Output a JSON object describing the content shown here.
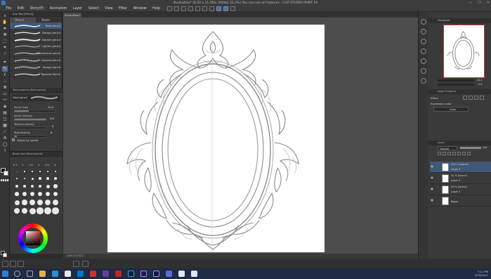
{
  "window": {
    "title": "Illustration* (8.50 x 11.00in 300dpi 32.2%) You can use all features - CLIP STUDIO PAINT EX",
    "controls": [
      "—",
      "☐",
      "✕"
    ]
  },
  "menu": [
    "File",
    "Edit",
    "Story(P)",
    "Animation",
    "Layer",
    "Select",
    "View",
    "Filter",
    "Window",
    "Help"
  ],
  "document_tab": "Illustration*",
  "subtool_panel": {
    "header": "Sub Tool [Pencil]",
    "tabs": [
      "Pencil",
      "Pastel"
    ],
    "brushes": [
      "Real pencil",
      "Design pencil",
      "Darker pencil",
      "Lighter pencil",
      "Mechanical pencil",
      "Colored pencil",
      "Rough pencil",
      "Tapered Pencil"
    ],
    "selected_index": 0
  },
  "tool_property": {
    "header": "Tool property [Real pencil]",
    "preset": "Real pencil",
    "brush_size_label": "Brush Size",
    "brush_size_value": "20.0",
    "brush_density_label": "Brush density",
    "brush_density_value": "100",
    "texture_density_label": "Texture density",
    "texture_density_value": "0",
    "stabilization_label": "Stabilization",
    "stabilization_value": "6",
    "adjust_by_speed_label": "Adjust by speed"
  },
  "brush_size_panel": {
    "header": "Brush size [Real pencil]",
    "sizes": [
      "0.7",
      "1",
      "1.5",
      "2",
      "2.5",
      "3"
    ]
  },
  "canvas": {
    "status": "1.8%  0.0  32.2"
  },
  "navigator": {
    "header": "Navigator",
    "zoom": "32.2",
    "rotation": "0.0"
  },
  "layer_property": {
    "header": "Layer Property",
    "effect_label": "Effect",
    "expression_color_label": "Expression color",
    "expression_color_value": "Color"
  },
  "layer_panel": {
    "header": "Layer",
    "blend_mode": "Normal",
    "opacity": "100",
    "layers": [
      {
        "mode": "100 % Normal",
        "name": "Layer 3",
        "selected": true
      },
      {
        "mode": "42 % Normal",
        "name": "Layer 2",
        "selected": false
      },
      {
        "mode": "49 % Normal",
        "name": "Layer 1",
        "selected": false
      },
      {
        "mode": "",
        "name": "Paper",
        "selected": false
      }
    ]
  },
  "taskbar": {
    "time": "7:11 PM",
    "date": "2/15/2021"
  },
  "colors": {
    "accent": "#4e6e98",
    "selected_row": "#3f5878",
    "panel_bg": "#3a3a3a",
    "canvas_bg": "#4d4d4d",
    "navigator_frame": "#c0392b",
    "taskbar_bg": "#1f2a44"
  }
}
